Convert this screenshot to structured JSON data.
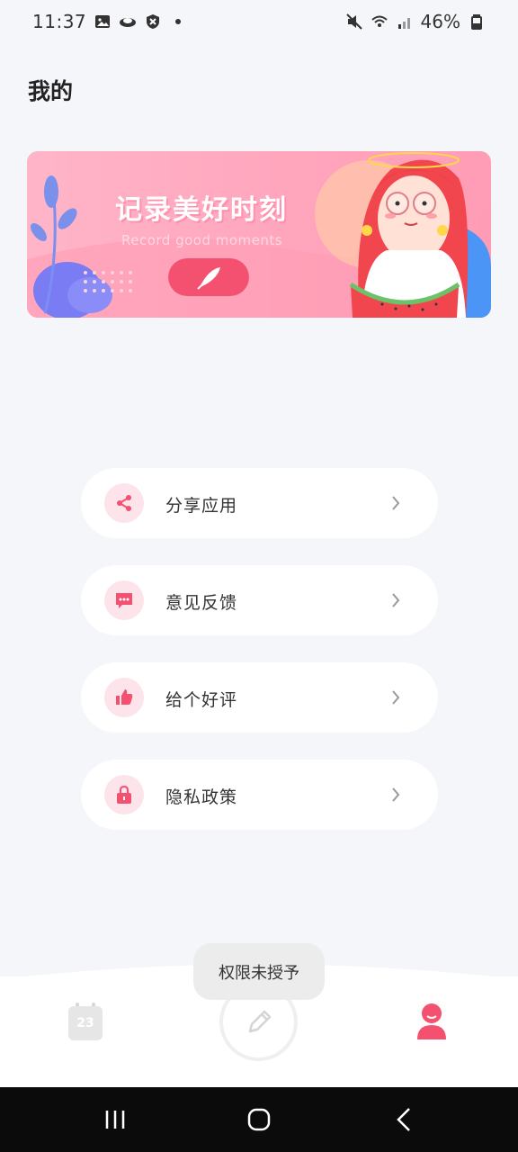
{
  "status": {
    "time": "11:37",
    "battery": "46%"
  },
  "page": {
    "title": "我的"
  },
  "banner": {
    "title": "记录美好时刻",
    "subtitle": "Record good moments"
  },
  "menu": [
    {
      "label": "分享应用",
      "icon": "share-icon"
    },
    {
      "label": "意见反馈",
      "icon": "feedback-icon"
    },
    {
      "label": "给个好评",
      "icon": "thumbs-up-icon"
    },
    {
      "label": "隐私政策",
      "icon": "lock-icon"
    }
  ],
  "toast": "权限未授予",
  "tabbar": {
    "calendar_day": "23"
  },
  "colors": {
    "accent": "#f4506f",
    "icon_bg": "#fde3ea",
    "background": "#f5f6fa"
  }
}
